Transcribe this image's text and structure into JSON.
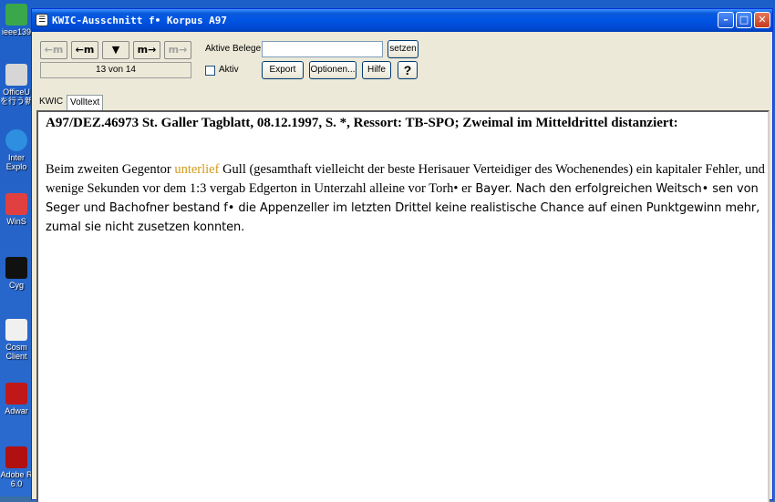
{
  "desktop": {
    "icons": [
      {
        "label": "ieee139",
        "name": "ieee-icon"
      },
      {
        "label": "OfficeU\nを行う新",
        "name": "office-icon"
      },
      {
        "label": "Inter\nExplo",
        "name": "internet-explorer-icon"
      },
      {
        "label": "WinS",
        "name": "winscp-icon"
      },
      {
        "label": "Cyg",
        "name": "cygwin-icon"
      },
      {
        "label": "Cosm\nClient",
        "name": "cosmas-client-icon"
      },
      {
        "label": "Adwar",
        "name": "adware-icon"
      },
      {
        "label": "Adobe R\n6.0",
        "name": "adobe-reader-icon"
      }
    ]
  },
  "window": {
    "title": "KWIC-Ausschnitt f• Korpus A97",
    "title_icon": "☰",
    "minimize": "–",
    "maximize": "□",
    "close": "✕"
  },
  "toolbar": {
    "nav": {
      "first": "←m",
      "prev": "←m",
      "center": "▼",
      "next": "m→",
      "last": "m→"
    },
    "counter": "13 von 14",
    "aktive_belege_label": "Aktive Belege:",
    "aktive_belege_value": "",
    "setzen": "setzen",
    "aktiv_label": "Aktiv",
    "export": "Export",
    "optionen": "Optionen...",
    "hilfe": "Hilfe",
    "help_glyph": "?"
  },
  "tabs": [
    {
      "label": "KWIC",
      "active": false
    },
    {
      "label": "Volltext",
      "active": true
    }
  ],
  "document": {
    "header": "A97/DEZ.46973 St. Galler Tagblatt, 08.12.1997, S. *, Ressort: TB-SPO; Zweimal im Mitteldrittel distanziert:",
    "para_before": "Beim zweiten Gegentor ",
    "keyword": "unterlief",
    "para_after_serif": " Gull (gesamthaft vielleicht der beste Herisauer Verteidiger des Wochenendes) ein kapitaler Fehler, und wenige Sekunden vor dem 1:3 vergab Edgerton in Unterzahl alleine vor Torh• er",
    "para_after_sans": " Bayer. Nach den erfolgreichen Weitsch• sen von Seger und Bachofner bestand f•  die Appenzeller im letzten Drittel keine realistische Chance auf einen Punktgewinn mehr, zumal sie nicht zusetzen konnten."
  },
  "colors": {
    "keyword": "#d49a1a",
    "titlebar": "#0054e3",
    "window_bg": "#ece9d8"
  }
}
